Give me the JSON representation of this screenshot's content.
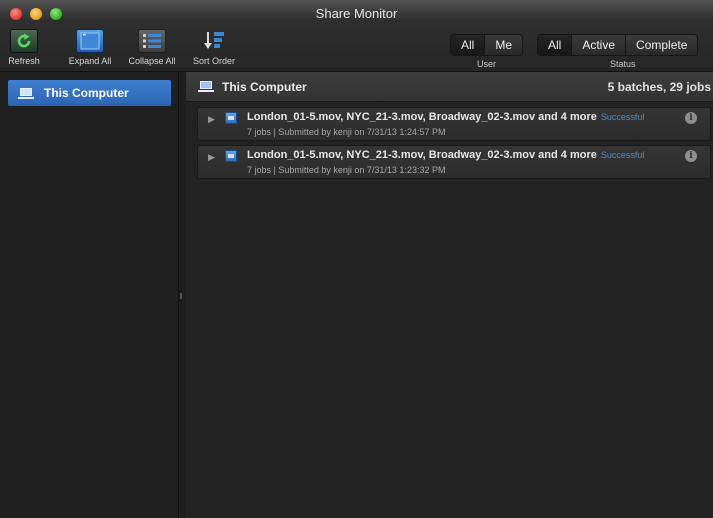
{
  "window": {
    "title": "Share Monitor"
  },
  "toolbar": {
    "refresh_label": "Refresh",
    "expand_all_label": "Expand All",
    "collapse_all_label": "Collapse All",
    "sort_order_label": "Sort Order",
    "user_filter": {
      "caption": "User",
      "options": [
        "All",
        "Me"
      ],
      "selected": "All"
    },
    "status_filter": {
      "caption": "Status",
      "options": [
        "All",
        "Active",
        "Complete"
      ],
      "selected": "All"
    }
  },
  "sidebar": {
    "items": [
      {
        "label": "This Computer",
        "icon": "computer-icon",
        "selected": true
      }
    ]
  },
  "main": {
    "group": {
      "name": "This Computer",
      "summary": "5 batches, 29 jobs"
    },
    "jobs": [
      {
        "title": "London_01-5.mov, NYC_21-3.mov, Broadway_02-3.mov and 4 more",
        "status": "Successful",
        "detail": "7 jobs  |  Submitted by kenji on 7/31/13 1:24:57 PM"
      },
      {
        "title": "London_01-5.mov, NYC_21-3.mov, Broadway_02-3.mov and 4 more",
        "status": "Successful",
        "detail": "7 jobs  |  Submitted by kenji on 7/31/13 1:23:32 PM"
      }
    ]
  },
  "colors": {
    "selection_blue": "#2c64b2",
    "status_blue": "#4b8fd8",
    "background": "#232323"
  }
}
